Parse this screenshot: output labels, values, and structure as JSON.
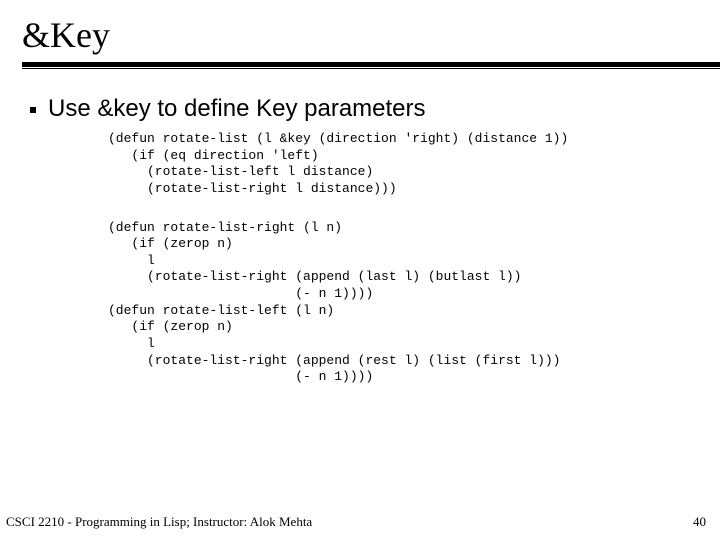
{
  "title": "&Key",
  "bullet": "Use &key to define Key parameters",
  "code1": "(defun rotate-list (l &key (direction 'right) (distance 1))\n   (if (eq direction 'left)\n     (rotate-list-left l distance)\n     (rotate-list-right l distance)))",
  "code2": "(defun rotate-list-right (l n)\n   (if (zerop n)\n     l\n     (rotate-list-right (append (last l) (butlast l))\n                        (- n 1))))\n(defun rotate-list-left (l n)\n   (if (zerop n)\n     l\n     (rotate-list-right (append (rest l) (list (first l)))\n                        (- n 1))))",
  "footer_left": "CSCI 2210 - Programming in Lisp; Instructor: Alok Mehta",
  "footer_right": "40"
}
